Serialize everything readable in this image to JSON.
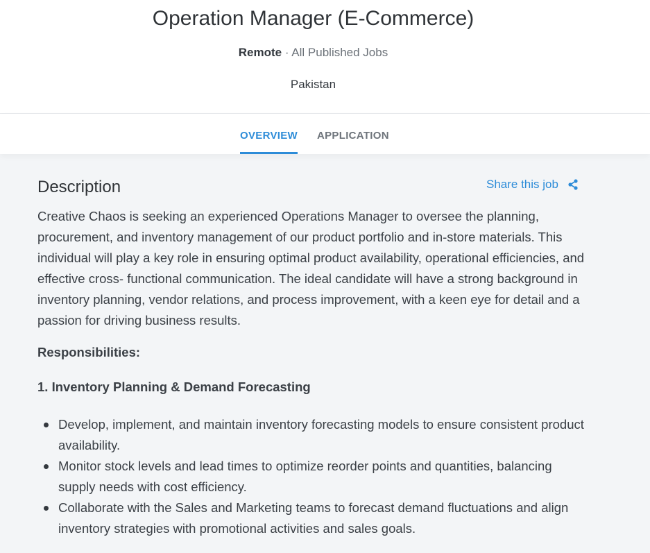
{
  "header": {
    "title": "Operation Manager (E-Commerce)",
    "workplace": "Remote",
    "separator": " · ",
    "jobs_link": "All Published Jobs",
    "location": "Pakistan"
  },
  "tabs": [
    {
      "label": "OVERVIEW",
      "active": true
    },
    {
      "label": "APPLICATION",
      "active": false
    }
  ],
  "description": {
    "heading": "Description",
    "share_label": "Share this job",
    "share_icon": "share-icon",
    "paragraph": "Creative Chaos is seeking an experienced Operations Manager to oversee the planning, procurement, and inventory management of our product portfolio and in-store materials. This individual will play a key role in ensuring optimal product availability, operational efficiencies, and effective cross- functional communication. The ideal candidate will have a strong background in inventory planning, vendor relations, and process improvement, with a keen eye for detail and a passion for driving business results.",
    "responsibilities_heading": "Responsibilities:",
    "section_1_heading": "1. Inventory Planning & Demand Forecasting",
    "section_1_items": [
      "Develop, implement, and maintain inventory forecasting models to ensure consistent product availability.",
      "Monitor stock levels and lead times to optimize reorder points and quantities, balancing supply needs with cost efficiency.",
      "Collaborate with the Sales and Marketing teams to forecast demand fluctuations and align inventory strategies with promotional activities and sales goals."
    ]
  },
  "colors": {
    "accent": "#2d8cd8",
    "background": "#f3f5f7"
  }
}
